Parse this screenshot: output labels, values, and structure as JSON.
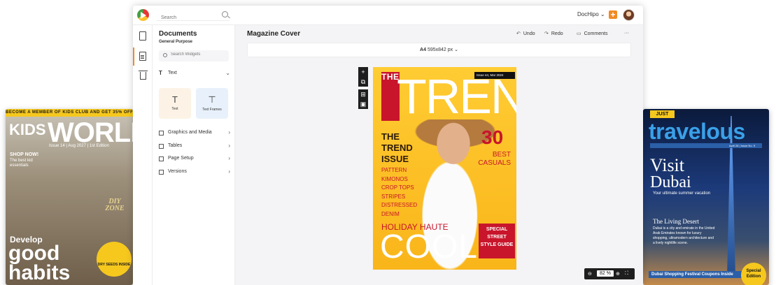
{
  "left_magazine": {
    "promo": "BECOME A MEMBER OF KIDS CLUB AND GET 35% OFF",
    "brand_small": "KIDS",
    "brand_big": "WORLD",
    "issue": "Issue 14 | Aug 2027 | 1st Edition",
    "shop": "SHOP NOW!",
    "shop_sub": "The best kid essentials",
    "diy": "DIY ZONE",
    "develop": "Develop",
    "good": "good",
    "habits": "habits",
    "seeds": "DRY SEEDS INSIDE"
  },
  "right_magazine": {
    "just": "JUST",
    "brand": "travelous",
    "strip": "April 28 | Issue No. 9",
    "visit": "Visit",
    "dubai": "Dubai",
    "tagline": "Your ultimate summer vacation",
    "desert": "The Living Desert",
    "desc": "Dubai is a city and emirate in the United Arab Emirates known for luxury shopping, ultramodern architecture and a lively nightlife scene.",
    "banner": "Dubai Shopping Festival Coupons Inside",
    "special": "Special Edition"
  },
  "topnav": {
    "search_placeholder": "Search",
    "account": "DocHipo ⌄",
    "plus": "+"
  },
  "panel": {
    "title": "Documents",
    "subtitle": "General Purpose",
    "search_placeholder": "Search Widgets",
    "text_section": "Text",
    "tile_text": "Text",
    "tile_frames": "Text Frames",
    "graphics": "Graphics and Media",
    "tables": "Tables",
    "page_setup": "Page Setup",
    "versions": "Versions"
  },
  "editor": {
    "doc_title": "Magazine Cover",
    "undo": "Undo",
    "redo": "Redo",
    "comments": "Comments",
    "more": "···",
    "size_label": "A4",
    "size_value": "595x842 px ⌄",
    "zoom": "82",
    "zoom_unit": "%"
  },
  "cover": {
    "the": "THE",
    "trenz": "TRENZ",
    "issue": "Issue 44, Mar 2024",
    "headline": "THE TREND ISSUE",
    "items": [
      "PATTERN",
      "KIMONOS",
      "CROP TOPS",
      "STRIPES",
      "DISTRESSED",
      "DENIM"
    ],
    "thirty": "30",
    "best": "BEST CASUALS",
    "holiday": "HOLIDAY HAUTE",
    "cool": "COOL",
    "box": "SPECIAL STREET STYLE GUIDE"
  }
}
